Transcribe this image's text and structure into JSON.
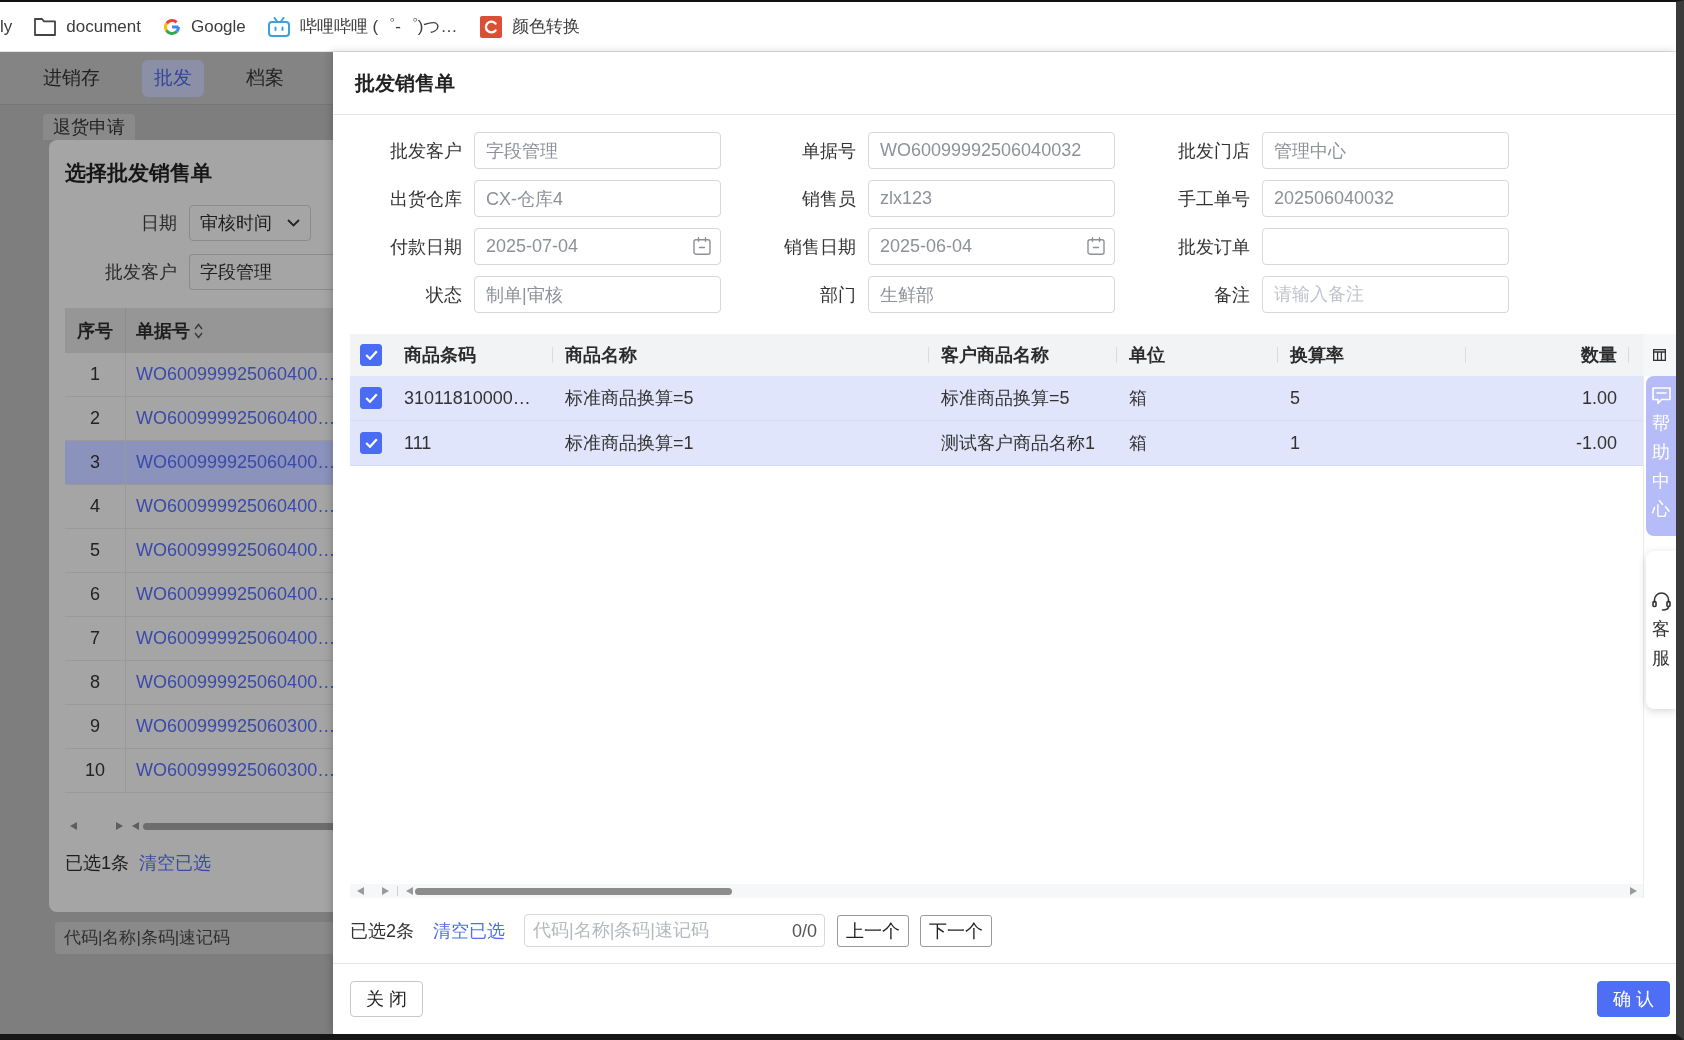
{
  "bookmarks_bar": {
    "items": [
      {
        "kind": "plain",
        "label": "ly"
      },
      {
        "kind": "folder",
        "label": "document"
      },
      {
        "kind": "google",
        "label": "Google"
      },
      {
        "kind": "bilibili",
        "label": "哔哩哔哩 (゜-゜)つ…"
      },
      {
        "kind": "color_tool",
        "label": "颜色转换"
      }
    ]
  },
  "background_page": {
    "nav": [
      {
        "label": "进销存",
        "selected": false
      },
      {
        "label": "批发",
        "selected": true
      },
      {
        "label": "档案",
        "selected": false
      }
    ],
    "tab": {
      "label": "退货申请"
    },
    "modal": {
      "title": "选择批发销售单",
      "filters": [
        {
          "kind": "select",
          "label": "日期",
          "value": "审核时间"
        },
        {
          "kind": "input",
          "label": "批发客户",
          "value": "字段管理"
        }
      ],
      "table": {
        "columns": [
          {
            "label": "序号",
            "sortable": false
          },
          {
            "label": "单据号",
            "sortable": true
          }
        ],
        "rows": [
          {
            "index": "1",
            "document_no": "WO600999925060400…",
            "selected": false
          },
          {
            "index": "2",
            "document_no": "WO600999925060400…",
            "selected": false
          },
          {
            "index": "3",
            "document_no": "WO600999925060400…",
            "selected": true
          },
          {
            "index": "4",
            "document_no": "WO600999925060400…",
            "selected": false
          },
          {
            "index": "5",
            "document_no": "WO600999925060400…",
            "selected": false
          },
          {
            "index": "6",
            "document_no": "WO600999925060400…",
            "selected": false
          },
          {
            "index": "7",
            "document_no": "WO600999925060400…",
            "selected": false
          },
          {
            "index": "8",
            "document_no": "WO600999925060400…",
            "selected": false
          },
          {
            "index": "9",
            "document_no": "WO600999925060300…",
            "selected": false
          },
          {
            "index": "10",
            "document_no": "WO600999925060300…",
            "selected": false
          }
        ]
      },
      "selection_count": "已选1条",
      "clear_link": "清空已选"
    },
    "search": {
      "placeholder": "代码|名称|条码|速记码"
    }
  },
  "drawer": {
    "title": "批发销售单",
    "fields": [
      {
        "label": "批发客户",
        "kind": "text",
        "value": "字段管理",
        "disabled": true
      },
      {
        "label": "单据号",
        "kind": "text",
        "value": "WO60099992506040032",
        "disabled": true
      },
      {
        "label": "批发门店",
        "kind": "text",
        "value": "管理中心",
        "disabled": true
      },
      {
        "label": "出货仓库",
        "kind": "text",
        "value": "CX-仓库4",
        "disabled": true
      },
      {
        "label": "销售员",
        "kind": "text",
        "value": "zlx123",
        "disabled": true
      },
      {
        "label": "手工单号",
        "kind": "text",
        "value": "202506040032",
        "disabled": true
      },
      {
        "label": "付款日期",
        "kind": "date",
        "value": "2025-07-04",
        "disabled": true
      },
      {
        "label": "销售日期",
        "kind": "date",
        "value": "2025-06-04",
        "disabled": true
      },
      {
        "label": "批发订单",
        "kind": "text"
      },
      {
        "label": "状态",
        "kind": "text",
        "value": "制单|审核",
        "disabled": true
      },
      {
        "label": "部门",
        "kind": "text",
        "value": "生鲜部",
        "disabled": true
      },
      {
        "label": "备注",
        "kind": "text",
        "placeholder": "请输入备注"
      }
    ],
    "table": {
      "all_checked": true,
      "columns": [
        {
          "label": "商品条码",
          "kind": "text"
        },
        {
          "label": "商品名称",
          "kind": "text"
        },
        {
          "label": "客户商品名称",
          "kind": "text"
        },
        {
          "label": "单位",
          "kind": "text"
        },
        {
          "label": "换算率",
          "kind": "text"
        },
        {
          "label": "数量",
          "kind": "amount"
        }
      ],
      "rows": [
        {
          "checked": true,
          "cells": [
            "31011810000…",
            "标准商品换算=5",
            "标准商品换算=5",
            "箱",
            "5",
            "1.00"
          ]
        },
        {
          "checked": true,
          "cells": [
            "111",
            "标准商品换算=1",
            "测试客户商品名称1",
            "箱",
            "1",
            "-1.00"
          ]
        }
      ]
    },
    "selection_count": "已选2条",
    "clear_link": "清空已选",
    "search": {
      "placeholder": "代码|名称|条码|速记码",
      "count": "0/0"
    },
    "step_buttons": [
      "上一个",
      "下一个"
    ],
    "footer_buttons": [
      {
        "kind": "default",
        "label": "关 闭"
      },
      {
        "kind": "primary",
        "label": "确 认"
      }
    ]
  },
  "side_tabs": [
    {
      "kind": "help",
      "label": "帮助中心"
    },
    {
      "kind": "service",
      "label": "客服"
    }
  ]
}
